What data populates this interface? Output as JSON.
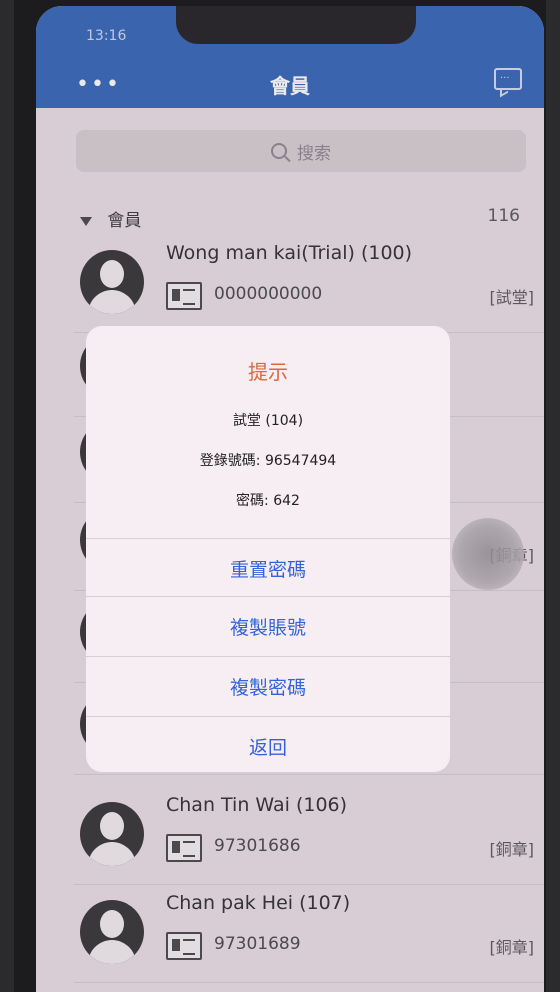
{
  "status": {
    "time": "13:16"
  },
  "header": {
    "title": "會員",
    "menu": "•••"
  },
  "search": {
    "placeholder": "搜索"
  },
  "section": {
    "title": "會員",
    "count": "116"
  },
  "members": [
    {
      "name": "Wong man kai(Trial) (100)",
      "phone": "0000000000",
      "badge": "[試堂]"
    },
    {
      "name": "",
      "phone": "",
      "badge": ""
    },
    {
      "name": "",
      "phone": "",
      "badge": ""
    },
    {
      "name": "",
      "phone": "",
      "badge": "[銅章]"
    },
    {
      "name": "",
      "phone": "",
      "badge": ""
    },
    {
      "name": "",
      "phone": "",
      "badge": ""
    },
    {
      "name": "Chan Tin Wai (106)",
      "phone": "97301686",
      "badge": "[銅章]"
    },
    {
      "name": "Chan pak Hei (107)",
      "phone": "97301689",
      "badge": "[銅章]"
    }
  ],
  "dialog": {
    "title": "提示",
    "line1": "試堂 (104)",
    "line2": "登錄號碼: 96547494",
    "line3": "密碼: 642",
    "btn_reset": "重置密碼",
    "btn_copy_account": "複製賬號",
    "btn_copy_password": "複製密碼",
    "btn_back": "返回"
  },
  "colors": {
    "header": "#2f64b8",
    "dialog_title": "#e0673a",
    "dialog_button": "#3462d8"
  }
}
